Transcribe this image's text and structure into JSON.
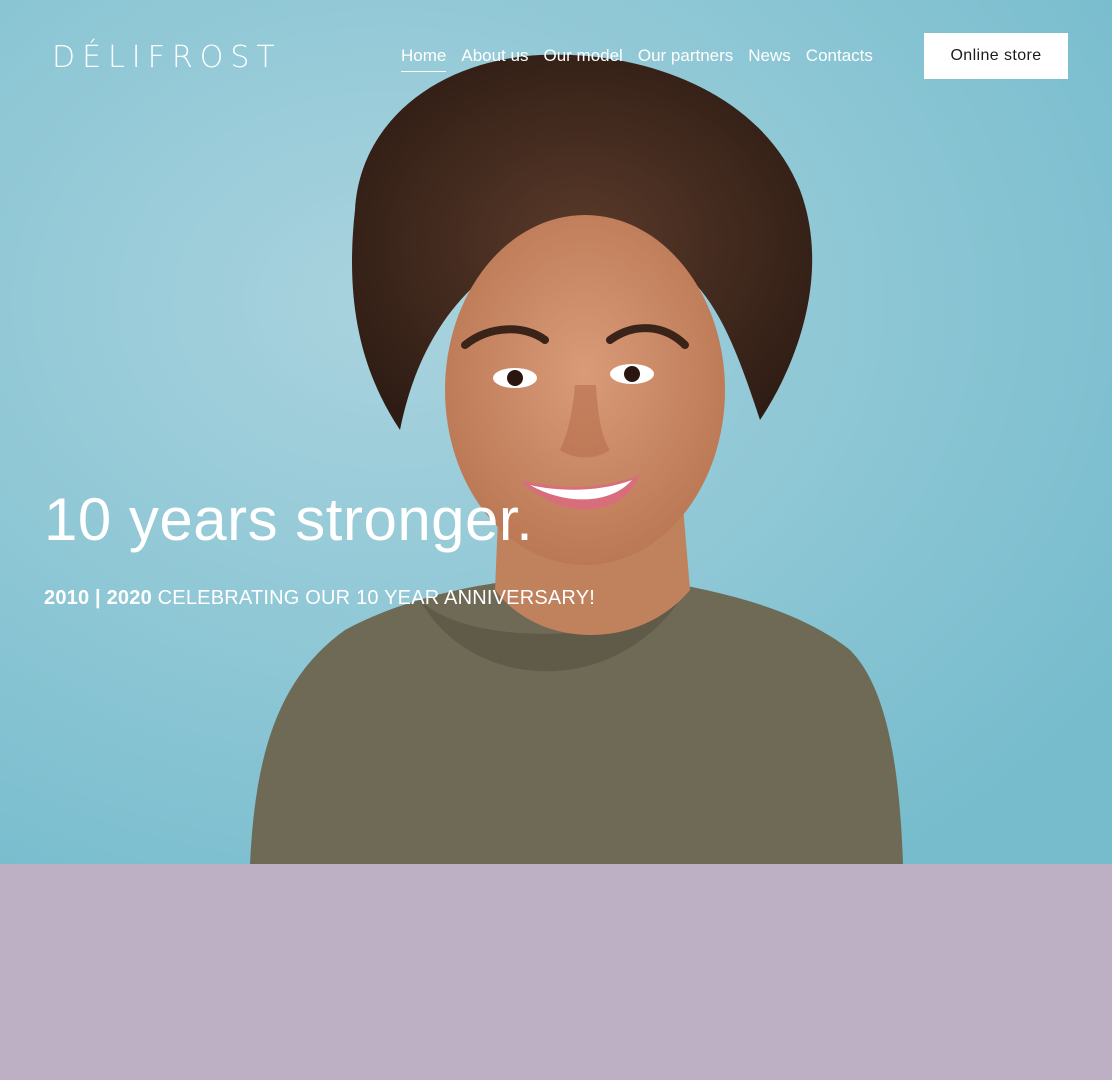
{
  "brand": {
    "logo_text": "DÉLIFROST"
  },
  "nav": {
    "items": [
      {
        "label": "Home",
        "active": true
      },
      {
        "label": "About us",
        "active": false
      },
      {
        "label": "Our model",
        "active": false
      },
      {
        "label": "Our partners",
        "active": false
      },
      {
        "label": "News",
        "active": false
      },
      {
        "label": "Contacts",
        "active": false
      }
    ],
    "store_button": "Online store"
  },
  "hero": {
    "title": "10 years stronger.",
    "years": "2010 | 2020",
    "caption": " CELEBRATING OUR 10 YEAR ANNIVERSARY!"
  },
  "colors": {
    "hero_background": "#8cc6d6",
    "section_background": "#bdb0c4",
    "text": "#ffffff",
    "button_background": "#ffffff",
    "button_text": "#1b1b1b"
  }
}
